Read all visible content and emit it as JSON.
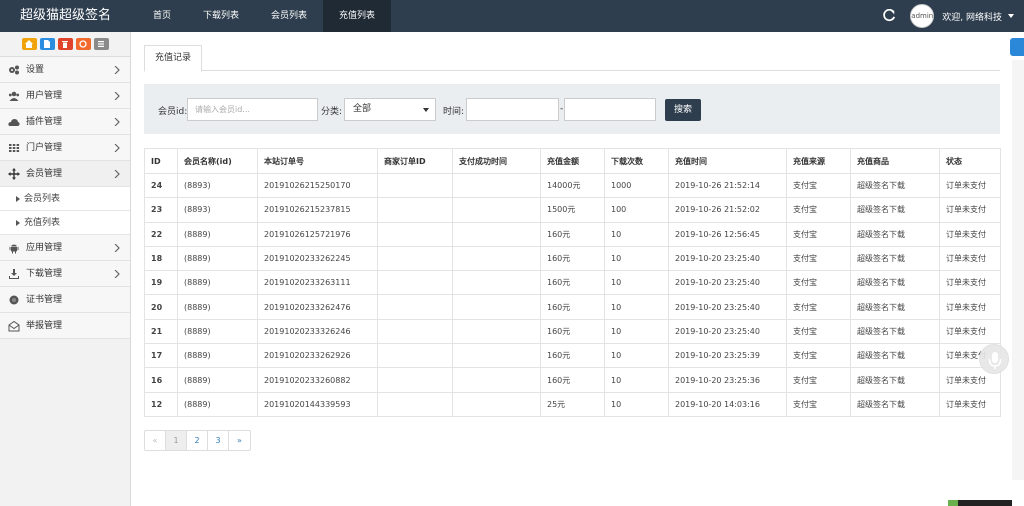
{
  "navbar": {
    "brand": "超级猫超级签名",
    "items": [
      {
        "label": "首页",
        "active": false
      },
      {
        "label": "下载列表",
        "active": false
      },
      {
        "label": "会员列表",
        "active": false
      },
      {
        "label": "充值列表",
        "active": true
      }
    ],
    "avatar_text": "admin",
    "welcome": "欢迎, 网络科技",
    "bg_color": "#2e3e4e"
  },
  "sidebar": {
    "shortcuts": [
      {
        "icon": "home-icon",
        "color": "#f0a30a"
      },
      {
        "icon": "file-icon",
        "color": "#2b8de0"
      },
      {
        "icon": "trash-icon",
        "color": "#e0432b"
      },
      {
        "icon": "recycle-icon",
        "color": "#f26a2b"
      },
      {
        "icon": "list-icon",
        "color": "#8a8a8a"
      }
    ],
    "items": [
      {
        "label": "设置",
        "icon": "gears-icon"
      },
      {
        "label": "用户管理",
        "icon": "users-icon"
      },
      {
        "label": "插件管理",
        "icon": "cloud-icon"
      },
      {
        "label": "门户管理",
        "icon": "grid-icon"
      },
      {
        "label": "会员管理",
        "icon": "move-icon",
        "open": true
      },
      {
        "label": "应用管理",
        "icon": "android-icon"
      },
      {
        "label": "下载管理",
        "icon": "download-icon"
      },
      {
        "label": "证书管理",
        "icon": "certificate-icon"
      },
      {
        "label": "举报管理",
        "icon": "envelope-icon"
      }
    ],
    "subitems": [
      {
        "label": "会员列表"
      },
      {
        "label": "充值列表"
      }
    ]
  },
  "main": {
    "tab": "充值记录",
    "filter": {
      "member_label": "会员id:",
      "member_placeholder": "请输入会员id...",
      "category_label": "分类:",
      "category_value": "全部",
      "time_label": "时间:",
      "dash": "-",
      "search_button": "搜索"
    },
    "table": {
      "headers": [
        "ID",
        "会员名称(id)",
        "本站订单号",
        "商家订单ID",
        "支付成功时间",
        "充值金额",
        "下载次数",
        "充值时间",
        "充值来源",
        "充值商品",
        "状态"
      ],
      "rows": [
        [
          "24",
          "(8893)",
          "20191026215250170",
          "",
          "",
          "14000元",
          "1000",
          "2019-10-26 21:52:14",
          "支付宝",
          "超级签名下载",
          "订单未支付"
        ],
        [
          "23",
          "(8893)",
          "20191026215237815",
          "",
          "",
          "1500元",
          "100",
          "2019-10-26 21:52:02",
          "支付宝",
          "超级签名下载",
          "订单未支付"
        ],
        [
          "22",
          "(8889)",
          "20191026125721976",
          "",
          "",
          "160元",
          "10",
          "2019-10-26 12:56:45",
          "支付宝",
          "超级签名下载",
          "订单未支付"
        ],
        [
          "18",
          "(8889)",
          "20191020233262245",
          "",
          "",
          "160元",
          "10",
          "2019-10-20 23:25:40",
          "支付宝",
          "超级签名下载",
          "订单未支付"
        ],
        [
          "19",
          "(8889)",
          "20191020233263111",
          "",
          "",
          "160元",
          "10",
          "2019-10-20 23:25:40",
          "支付宝",
          "超级签名下载",
          "订单未支付"
        ],
        [
          "20",
          "(8889)",
          "20191020233262476",
          "",
          "",
          "160元",
          "10",
          "2019-10-20 23:25:40",
          "支付宝",
          "超级签名下载",
          "订单未支付"
        ],
        [
          "21",
          "(8889)",
          "20191020233326246",
          "",
          "",
          "160元",
          "10",
          "2019-10-20 23:25:40",
          "支付宝",
          "超级签名下载",
          "订单未支付"
        ],
        [
          "17",
          "(8889)",
          "20191020233262926",
          "",
          "",
          "160元",
          "10",
          "2019-10-20 23:25:39",
          "支付宝",
          "超级签名下载",
          "订单未支付"
        ],
        [
          "16",
          "(8889)",
          "20191020233260882",
          "",
          "",
          "160元",
          "10",
          "2019-10-20 23:25:36",
          "支付宝",
          "超级签名下载",
          "订单未支付"
        ],
        [
          "12",
          "(8889)",
          "20191020144339593",
          "",
          "",
          "25元",
          "10",
          "2019-10-20 14:03:16",
          "支付宝",
          "超级签名下载",
          "订单未支付"
        ]
      ]
    },
    "pagination": {
      "prev": "«",
      "pages": [
        "1",
        "2",
        "3"
      ],
      "active": "1",
      "next": "»"
    }
  }
}
